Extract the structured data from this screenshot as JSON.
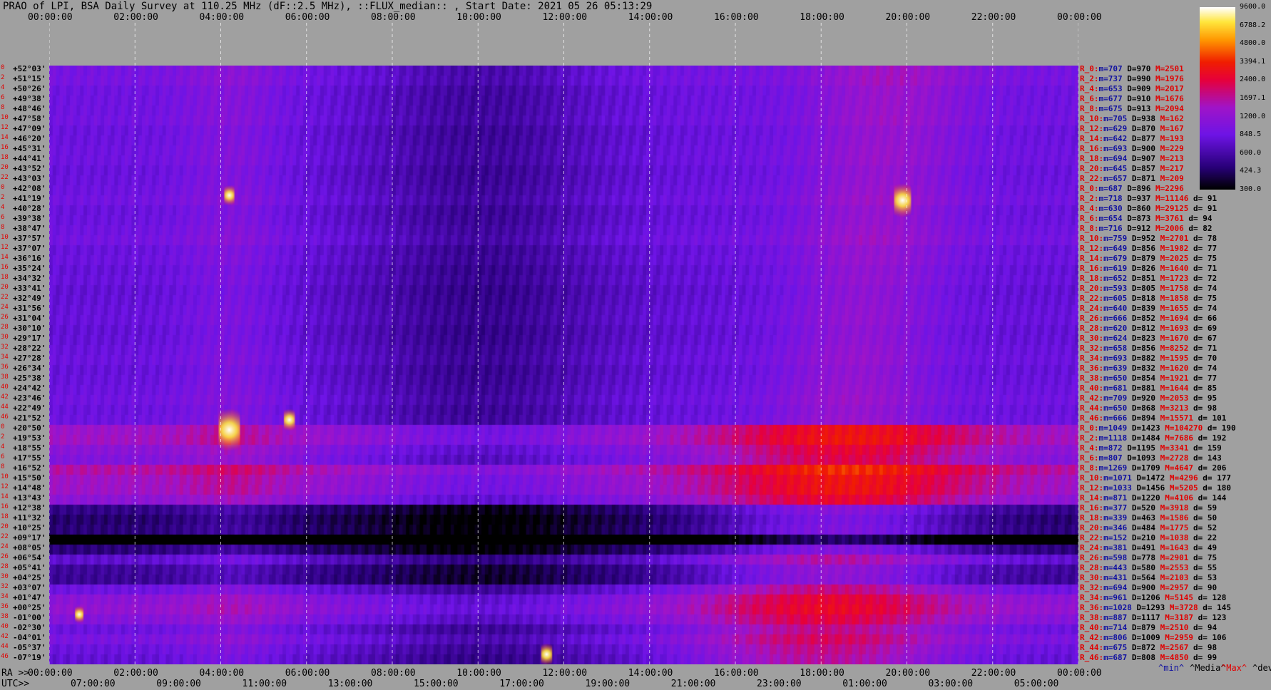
{
  "title": "PRAO of LPI, BSA Daily Survey at 110.25 MHz (dF::2.5 MHz), ::FLUX_median:: , Start Date: 2021 05 26 05:13:29",
  "chart_data": {
    "type": "heatmap",
    "title": "PRAO of LPI, BSA Daily Survey at 110.25 MHz (dF::2.5 MHz), ::FLUX_median:: , Start Date: 2021 05 26 05:13:29",
    "top_axis_ticks": [
      "00:00:00",
      "02:00:00",
      "04:00:00",
      "06:00:00",
      "08:00:00",
      "10:00:00",
      "12:00:00",
      "14:00:00",
      "16:00:00",
      "18:00:00",
      "20:00:00",
      "22:00:00",
      "00:00:00"
    ],
    "ra_axis_prefix": "RA >>",
    "ra_axis_ticks": [
      "00:00:00",
      "02:00:00",
      "04:00:00",
      "06:00:00",
      "08:00:00",
      "10:00:00",
      "12:00:00",
      "14:00:00",
      "16:00:00",
      "18:00:00",
      "20:00:00",
      "22:00:00",
      "00:00:00"
    ],
    "utc_axis_prefix": "UTC>>",
    "utc_axis_ticks": [
      "07:00:00",
      "09:00:00",
      "11:00:00",
      "13:00:00",
      "15:00:00",
      "17:00:00",
      "19:00:00",
      "21:00:00",
      "23:00:00",
      "01:00:00",
      "03:00:00",
      "05:00:00"
    ],
    "colorbar_ticks": [
      "9600.0",
      "6788.2",
      "4800.0",
      "3394.1",
      "2400.0",
      "1697.1",
      "1200.0",
      "848.5",
      "600.0",
      "424.3",
      "300.0"
    ],
    "colorbar_range": [
      300,
      9600
    ],
    "colorbar_scale": "log",
    "declination_labels": [
      "+52°03'",
      "+51°15'",
      "+50°26'",
      "+49°38'",
      "+48°46'",
      "+47°58'",
      "+47°09'",
      "+46°20'",
      "+45°31'",
      "+44°41'",
      "+43°52'",
      "+43°03'",
      "+42°08'",
      "+41°19'",
      "+40°28'",
      "+39°38'",
      "+38°47'",
      "+37°57'",
      "+37°07'",
      "+36°16'",
      "+35°24'",
      "+34°32'",
      "+33°41'",
      "+32°49'",
      "+31°56'",
      "+31°04'",
      "+30°10'",
      "+29°17'",
      "+28°22'",
      "+27°28'",
      "+26°34'",
      "+25°38'",
      "+24°42'",
      "+23°46'",
      "+22°49'",
      "+21°52'",
      "+20°50'",
      "+19°53'",
      "+18°55'",
      "+17°55'",
      "+16°52'",
      "+15°50'",
      "+14°48'",
      "+13°43'",
      "+12°38'",
      "+11°32'",
      "+10°25'",
      "+09°17'",
      "+08°05'",
      "+06°54'",
      "+05°41'",
      "+04°25'",
      "+03°07'",
      "+01°47'",
      "+00°25'",
      "-01°00'",
      "-02°30'",
      "-04°01'",
      "-05°37'",
      "-07°19'"
    ],
    "declination_row_numbers": [
      0,
      2,
      4,
      6,
      8,
      10,
      12,
      14,
      16,
      18,
      20,
      22,
      0,
      2,
      4,
      6,
      8,
      10,
      12,
      14,
      16,
      18,
      20,
      22,
      24,
      26,
      28,
      30,
      32,
      34,
      36,
      38,
      40,
      42,
      44,
      46,
      0,
      2,
      4,
      6,
      8,
      10,
      12,
      14,
      16,
      18,
      20,
      22,
      24,
      26,
      28,
      30,
      32,
      34,
      36,
      38,
      40,
      42,
      44,
      46
    ],
    "row_stats": [
      {
        "r": "R_0:",
        "m": "707",
        "D": "970",
        "M": "2501",
        "d": ""
      },
      {
        "r": "R_2:",
        "m": "737",
        "D": "990",
        "M": "1976",
        "d": ""
      },
      {
        "r": "R_4:",
        "m": "653",
        "D": "909",
        "M": "2017",
        "d": ""
      },
      {
        "r": "R_6:",
        "m": "677",
        "D": "910",
        "M": "1676",
        "d": ""
      },
      {
        "r": "R_8:",
        "m": "675",
        "D": "913",
        "M": "2094",
        "d": ""
      },
      {
        "r": "R_10:",
        "m": "705",
        "D": "938",
        "M": "162",
        "d": ""
      },
      {
        "r": "R_12:",
        "m": "629",
        "D": "870",
        "M": "167",
        "d": ""
      },
      {
        "r": "R_14:",
        "m": "642",
        "D": "877",
        "M": "193",
        "d": ""
      },
      {
        "r": "R_16:",
        "m": "693",
        "D": "900",
        "M": "229",
        "d": ""
      },
      {
        "r": "R_18:",
        "m": "694",
        "D": "907",
        "M": "213",
        "d": ""
      },
      {
        "r": "R_20:",
        "m": "645",
        "D": "857",
        "M": "217",
        "d": ""
      },
      {
        "r": "R_22:",
        "m": "657",
        "D": "871",
        "M": "209",
        "d": ""
      },
      {
        "r": "R_0:",
        "m": "687",
        "D": "896",
        "M": "2296",
        "d": ""
      },
      {
        "r": "R_2:",
        "m": "718",
        "D": "937",
        "M": "11146",
        "d": "91"
      },
      {
        "r": "R_4:",
        "m": "630",
        "D": "860",
        "M": "29125",
        "d": "91"
      },
      {
        "r": "R_6:",
        "m": "654",
        "D": "873",
        "M": "3761",
        "d": "94"
      },
      {
        "r": "R_8:",
        "m": "716",
        "D": "912",
        "M": "2006",
        "d": "82"
      },
      {
        "r": "R_10:",
        "m": "759",
        "D": "952",
        "M": "2701",
        "d": "78"
      },
      {
        "r": "R_12:",
        "m": "649",
        "D": "856",
        "M": "1982",
        "d": "77"
      },
      {
        "r": "R_14:",
        "m": "679",
        "D": "879",
        "M": "2025",
        "d": "75"
      },
      {
        "r": "R_16:",
        "m": "619",
        "D": "826",
        "M": "1640",
        "d": "71"
      },
      {
        "r": "R_18:",
        "m": "652",
        "D": "851",
        "M": "1723",
        "d": "72"
      },
      {
        "r": "R_20:",
        "m": "593",
        "D": "805",
        "M": "1758",
        "d": "74"
      },
      {
        "r": "R_22:",
        "m": "605",
        "D": "818",
        "M": "1858",
        "d": "75"
      },
      {
        "r": "R_24:",
        "m": "640",
        "D": "839",
        "M": "1655",
        "d": "74"
      },
      {
        "r": "R_26:",
        "m": "666",
        "D": "852",
        "M": "1694",
        "d": "66"
      },
      {
        "r": "R_28:",
        "m": "620",
        "D": "812",
        "M": "1693",
        "d": "69"
      },
      {
        "r": "R_30:",
        "m": "624",
        "D": "823",
        "M": "1670",
        "d": "67"
      },
      {
        "r": "R_32:",
        "m": "658",
        "D": "856",
        "M": "8252",
        "d": "71"
      },
      {
        "r": "R_34:",
        "m": "693",
        "D": "882",
        "M": "1595",
        "d": "70"
      },
      {
        "r": "R_36:",
        "m": "639",
        "D": "832",
        "M": "1620",
        "d": "74"
      },
      {
        "r": "R_38:",
        "m": "650",
        "D": "854",
        "M": "1921",
        "d": "77"
      },
      {
        "r": "R_40:",
        "m": "681",
        "D": "881",
        "M": "1644",
        "d": "85"
      },
      {
        "r": "R_42:",
        "m": "709",
        "D": "920",
        "M": "2053",
        "d": "95"
      },
      {
        "r": "R_44:",
        "m": "650",
        "D": "868",
        "M": "3213",
        "d": "98"
      },
      {
        "r": "R_46:",
        "m": "666",
        "D": "894",
        "M": "15571",
        "d": "101"
      },
      {
        "r": "R_0:",
        "m": "1049",
        "D": "1423",
        "M": "104270",
        "d": "190"
      },
      {
        "r": "R_2:",
        "m": "1118",
        "D": "1484",
        "M": "7686",
        "d": "192"
      },
      {
        "r": "R_4:",
        "m": "872",
        "D": "1195",
        "M": "3341",
        "d": "159"
      },
      {
        "r": "R_6:",
        "m": "807",
        "D": "1093",
        "M": "2728",
        "d": "143"
      },
      {
        "r": "R_8:",
        "m": "1269",
        "D": "1709",
        "M": "4647",
        "d": "206"
      },
      {
        "r": "R_10:",
        "m": "1071",
        "D": "1472",
        "M": "4296",
        "d": "177"
      },
      {
        "r": "R_12:",
        "m": "1033",
        "D": "1456",
        "M": "5205",
        "d": "180"
      },
      {
        "r": "R_14:",
        "m": "871",
        "D": "1220",
        "M": "4106",
        "d": "144"
      },
      {
        "r": "R_16:",
        "m": "377",
        "D": "520",
        "M": "3918",
        "d": "59"
      },
      {
        "r": "R_18:",
        "m": "339",
        "D": "463",
        "M": "1586",
        "d": "50"
      },
      {
        "r": "R_20:",
        "m": "346",
        "D": "484",
        "M": "1775",
        "d": "52"
      },
      {
        "r": "R_22:",
        "m": "152",
        "D": "210",
        "M": "1038",
        "d": "22"
      },
      {
        "r": "R_24:",
        "m": "381",
        "D": "491",
        "M": "1643",
        "d": "49"
      },
      {
        "r": "R_26:",
        "m": "598",
        "D": "778",
        "M": "2901",
        "d": "75"
      },
      {
        "r": "R_28:",
        "m": "443",
        "D": "580",
        "M": "2553",
        "d": "55"
      },
      {
        "r": "R_30:",
        "m": "431",
        "D": "564",
        "M": "2103",
        "d": "53"
      },
      {
        "r": "R_32:",
        "m": "694",
        "D": "900",
        "M": "2957",
        "d": "90"
      },
      {
        "r": "R_34:",
        "m": "961",
        "D": "1206",
        "M": "5145",
        "d": "128"
      },
      {
        "r": "R_36:",
        "m": "1028",
        "D": "1293",
        "M": "3728",
        "d": "145"
      },
      {
        "r": "R_38:",
        "m": "887",
        "D": "1117",
        "M": "3187",
        "d": "123"
      },
      {
        "r": "R_40:",
        "m": "714",
        "D": "879",
        "M": "2510",
        "d": "94"
      },
      {
        "r": "R_42:",
        "m": "806",
        "D": "1009",
        "M": "2959",
        "d": "106"
      },
      {
        "r": "R_44:",
        "m": "675",
        "D": "872",
        "M": "2567",
        "d": "98"
      },
      {
        "r": "R_46:",
        "m": "687",
        "D": "808",
        "M": "4850",
        "d": "99"
      }
    ],
    "stats_legend": [
      "^min^",
      "^Media^",
      "^Max^",
      "^devia^"
    ],
    "rows": 60,
    "cols": 300
  }
}
